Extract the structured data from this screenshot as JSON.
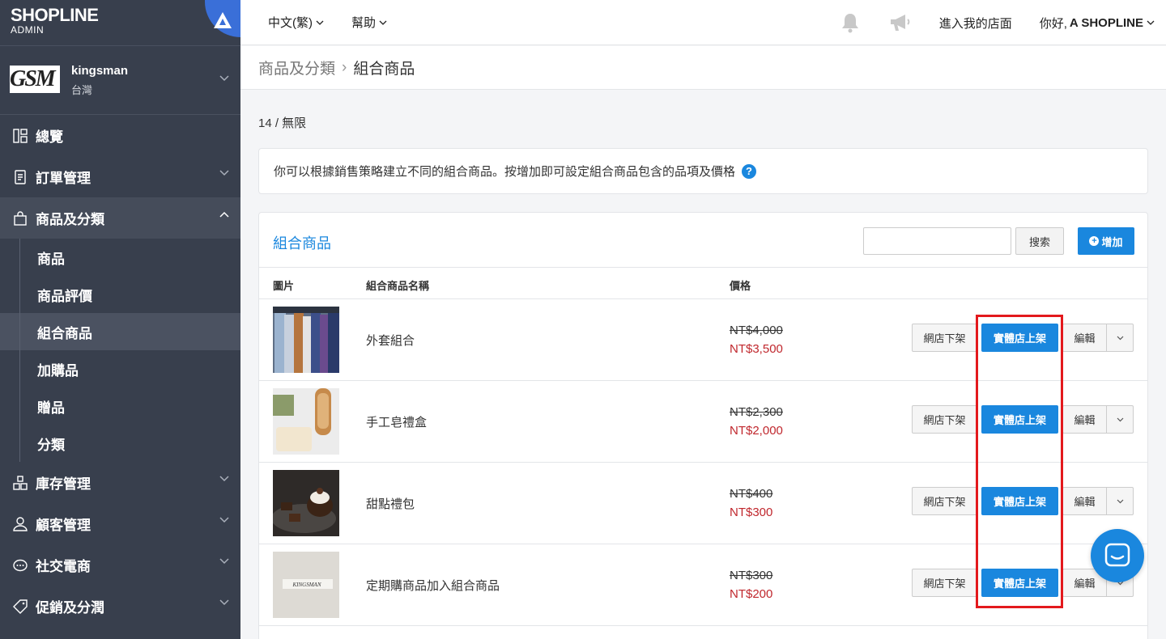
{
  "brand": {
    "logo": "SHOPLINE",
    "sub": "ADMIN"
  },
  "store": {
    "logo_text": "GSM",
    "name": "kingsman",
    "region": "台灣"
  },
  "sidebar": {
    "items": [
      {
        "label": "總覽",
        "icon": "dashboard-icon"
      },
      {
        "label": "訂單管理",
        "icon": "orders-icon"
      },
      {
        "label": "商品及分類",
        "icon": "bag-icon"
      },
      {
        "label": "庫存管理",
        "icon": "inventory-icon"
      },
      {
        "label": "顧客管理",
        "icon": "user-icon"
      },
      {
        "label": "社交電商",
        "icon": "chat-icon"
      },
      {
        "label": "促銷及分潤",
        "icon": "tag-icon"
      }
    ],
    "sub_items": [
      "商品",
      "商品評價",
      "組合商品",
      "加購品",
      "贈品",
      "分類"
    ]
  },
  "topbar": {
    "language": "中文(繁)",
    "help": "幫助",
    "enter_store": "進入我的店面",
    "greeting": "你好,",
    "username": "A SHOPLINE"
  },
  "breadcrumb": {
    "parent": "商品及分類",
    "current": "組合商品"
  },
  "count": "14 / 無限",
  "info": "你可以根據銷售策略建立不同的組合商品。按增加即可設定組合商品包含的品項及價格",
  "panel": {
    "title": "組合商品",
    "search_button": "搜索",
    "add_button": "增加",
    "columns": {
      "image": "圖片",
      "name": "組合商品名稱",
      "price": "價格"
    }
  },
  "buttons": {
    "offline": "網店下架",
    "online": "實體店上架",
    "edit": "編輯"
  },
  "rows": [
    {
      "name": "外套組合",
      "original": "NT$4,000",
      "sale": "NT$3,500"
    },
    {
      "name": "手工皂禮盒",
      "original": "NT$2,300",
      "sale": "NT$2,000"
    },
    {
      "name": "甜點禮包",
      "original": "NT$400",
      "sale": "NT$300"
    },
    {
      "name": "定期購商品加入組合商品",
      "original": "NT$300",
      "sale": "NT$200"
    }
  ],
  "thumb_label": "KINGSMAN",
  "colors": {
    "sidebar": "#383f4d",
    "accent": "#1a87de",
    "sale": "#c0272d",
    "highlight": "#e3191d"
  }
}
